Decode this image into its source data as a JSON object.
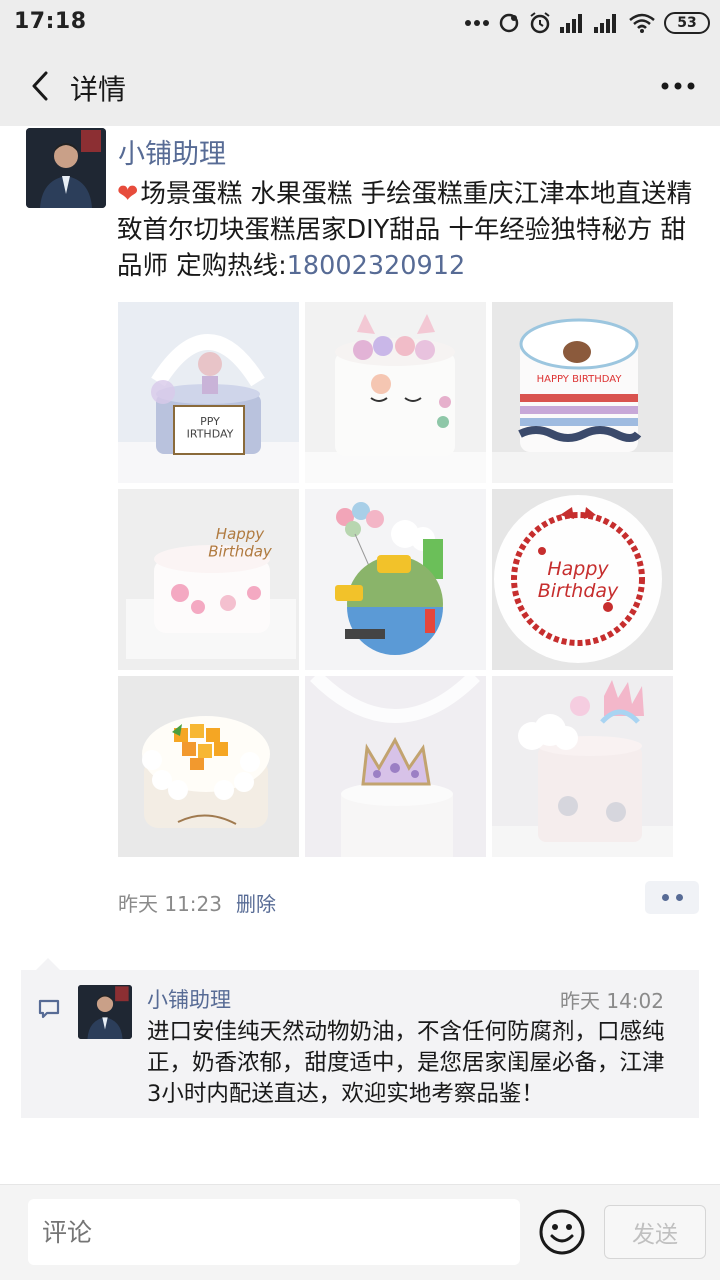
{
  "status_bar": {
    "time": "17:18",
    "battery": "53"
  },
  "nav": {
    "title": "详情"
  },
  "post": {
    "author": "小铺助理",
    "text_body": "场景蛋糕 水果蛋糕 手绘蛋糕重庆江津本地直送精致首尔切块蛋糕居家DIY甜品 十年经验独特秘方 甜品师 定购热线:",
    "phone": "18002320912",
    "time": "昨天 11:23",
    "delete_label": "删除",
    "images": [
      {
        "icon": "cake-photo",
        "caption": "PPY\nIRTHDAY"
      },
      {
        "icon": "cake-photo",
        "caption": ""
      },
      {
        "icon": "cake-photo",
        "caption": "HAPPY BIRTHDAY"
      },
      {
        "icon": "cake-photo",
        "caption": "Happy\nBirthday"
      },
      {
        "icon": "cake-photo",
        "caption": ""
      },
      {
        "icon": "cake-photo",
        "caption": "Happy\nBirthday"
      },
      {
        "icon": "cake-photo",
        "caption": ""
      },
      {
        "icon": "cake-photo",
        "caption": ""
      },
      {
        "icon": "cake-photo",
        "caption": ""
      }
    ]
  },
  "comment": {
    "author": "小铺助理",
    "time": "昨天 14:02",
    "text": "进口安佳纯天然动物奶油，不含任何防腐剂，口感纯正，奶香浓郁，甜度适中，是您居家闺屋必备，江津3小时内配送直达，欢迎实地考察品鉴！"
  },
  "input": {
    "placeholder": "评论",
    "send_label": "发送"
  },
  "colors": {
    "link": "#576b95",
    "nav_bg": "#ededed",
    "heart": "#e74c3c"
  }
}
